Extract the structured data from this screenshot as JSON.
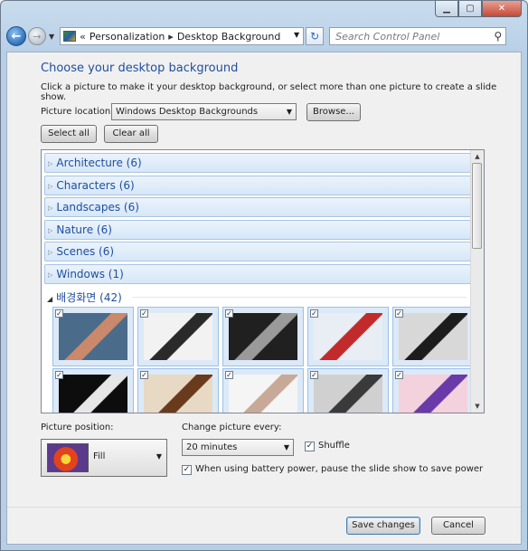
{
  "window": {
    "minimize_icon": "minimize-icon",
    "maximize_icon": "maximize-icon",
    "close_icon": "close-icon"
  },
  "nav": {
    "back_glyph": "←",
    "forward_glyph": "→",
    "breadcrumb_prefix": "«",
    "crumbs": [
      "Personalization",
      "Desktop Background"
    ],
    "search_placeholder": "Search Control Panel"
  },
  "page": {
    "title": "Choose your desktop background",
    "description": "Click a picture to make it your desktop background, or select more than one picture to create a slide show.",
    "location_label": "Picture location:",
    "location_value": "Windows Desktop Backgrounds",
    "browse_label": "Browse...",
    "select_all_label": "Select all",
    "clear_all_label": "Clear all"
  },
  "groups": [
    {
      "label": "Architecture (6)"
    },
    {
      "label": "Characters (6)"
    },
    {
      "label": "Landscapes (6)"
    },
    {
      "label": "Nature (6)"
    },
    {
      "label": "Scenes (6)"
    },
    {
      "label": "Windows (1)"
    }
  ],
  "expanded_group": {
    "label": "배경화면 (42)"
  },
  "tiles": [
    {
      "checked": true,
      "colors": [
        "#4a6b8a",
        "#c9896a"
      ]
    },
    {
      "checked": true,
      "colors": [
        "#f2f2f2",
        "#2a2a2a"
      ]
    },
    {
      "checked": true,
      "colors": [
        "#202020",
        "#9a9a9a"
      ]
    },
    {
      "checked": true,
      "colors": [
        "#e8eef4",
        "#c22b2b"
      ]
    },
    {
      "checked": true,
      "colors": [
        "#d8d8d8",
        "#1c1c1c"
      ]
    },
    {
      "checked": true,
      "colors": [
        "#0d0d0d",
        "#e6e6e6"
      ]
    },
    {
      "checked": true,
      "colors": [
        "#e8d9c4",
        "#6a3a1c"
      ]
    },
    {
      "checked": true,
      "colors": [
        "#f5f5f5",
        "#c8a896"
      ]
    },
    {
      "checked": true,
      "colors": [
        "#d0d0d0",
        "#3a3a3a"
      ]
    },
    {
      "checked": true,
      "colors": [
        "#f3d2de",
        "#6a3aa8"
      ]
    }
  ],
  "position": {
    "label": "Picture position:",
    "value": "Fill"
  },
  "slideshow": {
    "change_label": "Change picture every:",
    "interval": "20 minutes",
    "shuffle_label": "Shuffle",
    "shuffle_checked": true,
    "battery_label": "When using battery power, pause the slide show to save power",
    "battery_checked": true
  },
  "footer": {
    "save_label": "Save changes",
    "cancel_label": "Cancel"
  }
}
